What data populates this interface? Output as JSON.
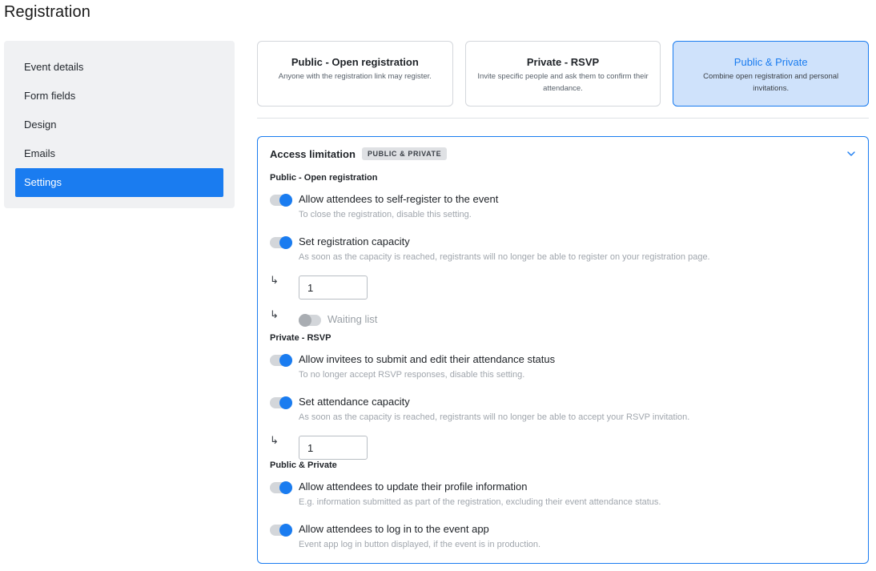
{
  "page": {
    "title": "Registration"
  },
  "sidebar": {
    "items": [
      {
        "label": "Event details"
      },
      {
        "label": "Form fields"
      },
      {
        "label": "Design"
      },
      {
        "label": "Emails"
      },
      {
        "label": "Settings",
        "active": true
      }
    ]
  },
  "registration_types": [
    {
      "title": "Public - Open registration",
      "desc": "Anyone with the registration link may register."
    },
    {
      "title": "Private - RSVP",
      "desc": "Invite specific people and ask them to confirm their attendance."
    },
    {
      "title": "Public & Private",
      "desc": "Combine open registration and personal invitations.",
      "selected": true
    }
  ],
  "access": {
    "title": "Access limitation",
    "badge": "PUBLIC & PRIVATE",
    "public_section": {
      "heading": "Public - Open registration",
      "self_register": {
        "label": "Allow attendees to self-register to the event",
        "help": "To close the registration, disable this setting.",
        "enabled": true
      },
      "capacity": {
        "label": "Set registration capacity",
        "help": "As soon as the capacity is reached, registrants will no longer be able to register on your registration page.",
        "enabled": true,
        "value": "1"
      },
      "waiting_list": {
        "label": "Waiting list",
        "enabled": false
      }
    },
    "private_section": {
      "heading": "Private - RSVP",
      "rsvp": {
        "label": "Allow invitees to submit and edit their attendance status",
        "help": "To no longer accept RSVP responses, disable this setting.",
        "enabled": true
      },
      "capacity": {
        "label": "Set attendance capacity",
        "help": "As soon as the capacity is reached, registrants will no longer be able to accept your RSVP invitation.",
        "enabled": true,
        "value": "1"
      }
    },
    "both_section": {
      "heading": "Public & Private",
      "profile": {
        "label": "Allow attendees to update their profile information",
        "help": "E.g. information submitted as part of the registration, excluding their event attendance status.",
        "enabled": true
      },
      "app_login": {
        "label": "Allow attendees to log in to the event app",
        "help": "Event app log in button displayed, if the event is in production.",
        "enabled": true
      }
    },
    "arrow_glyph": "↳"
  },
  "colors": {
    "accent": "#1a7cf0",
    "selected_bg": "#cfe2fb",
    "sidebar_bg": "#f0f1f3"
  }
}
